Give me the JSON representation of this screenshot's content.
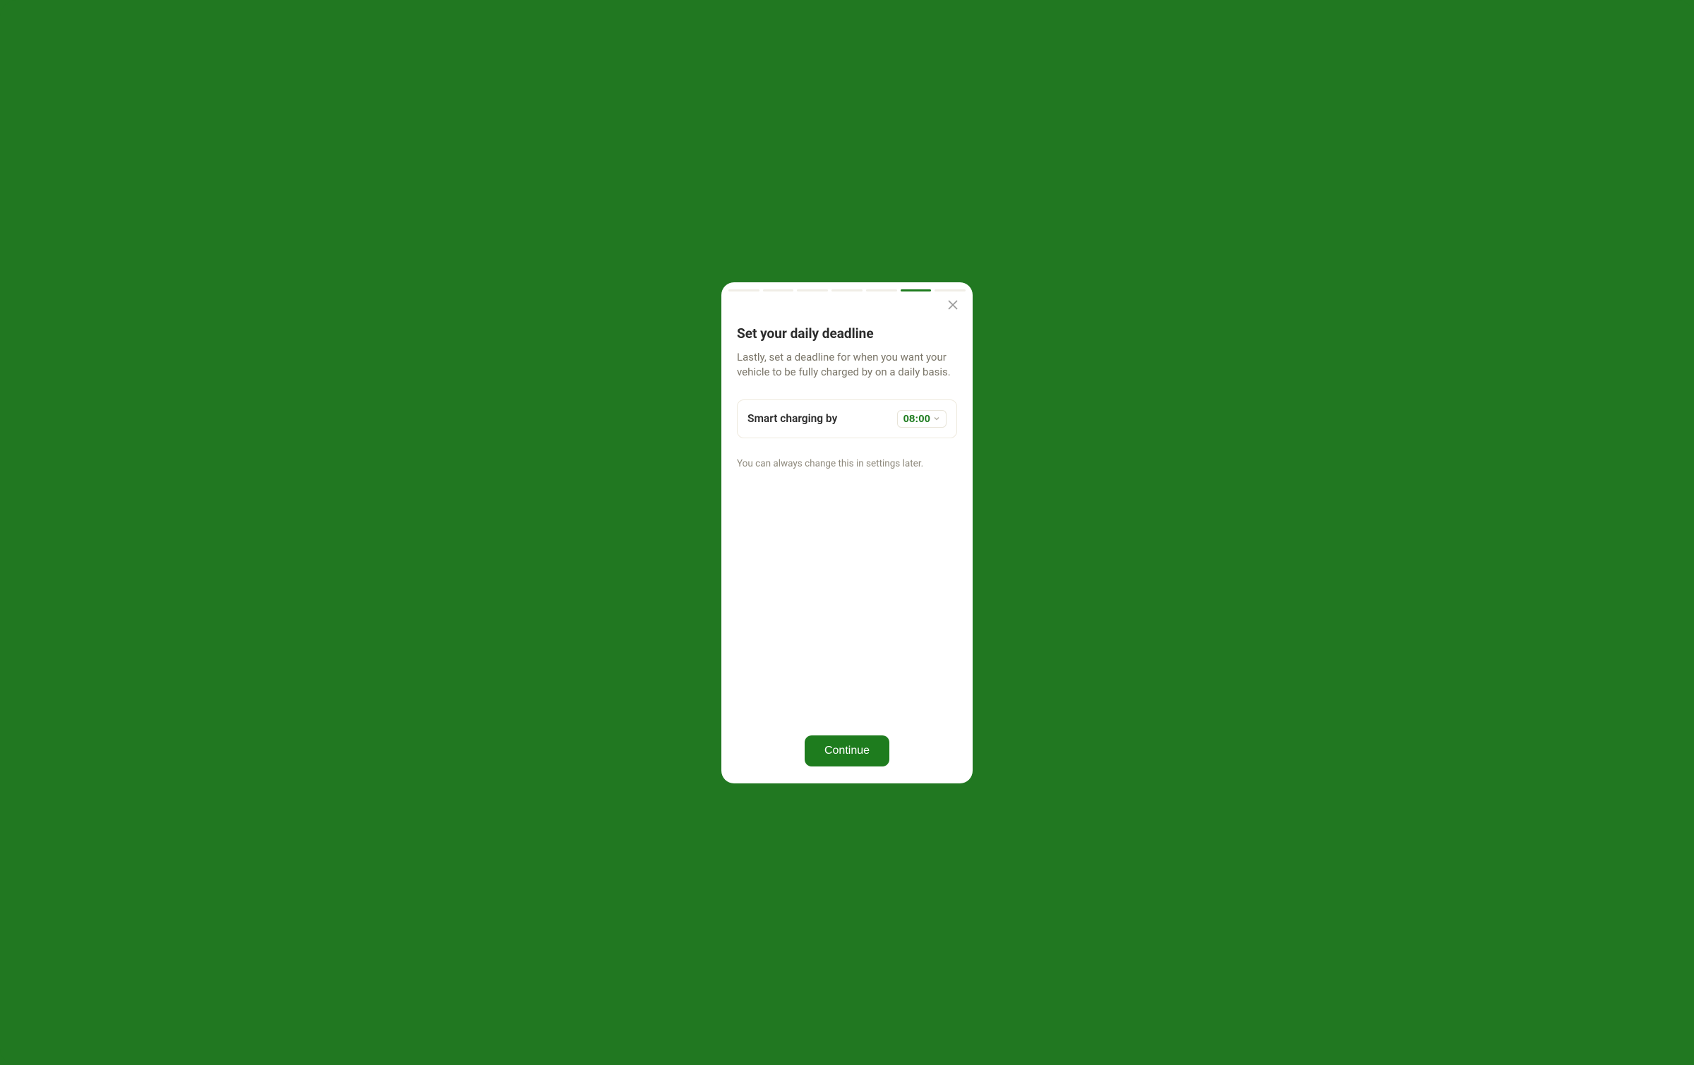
{
  "progress": {
    "total_steps": 7,
    "active_step_index": 5
  },
  "header": {
    "title": "Set your daily deadline",
    "description": "Lastly, set a deadline for when you want your vehicle to be fully charged by on a daily basis."
  },
  "form": {
    "field_label": "Smart charging by",
    "time_value": "08:00"
  },
  "helper_text": "You can always change this in settings later.",
  "footer": {
    "continue_label": "Continue"
  },
  "colors": {
    "background": "#217821",
    "accent": "#1e7c1e"
  }
}
